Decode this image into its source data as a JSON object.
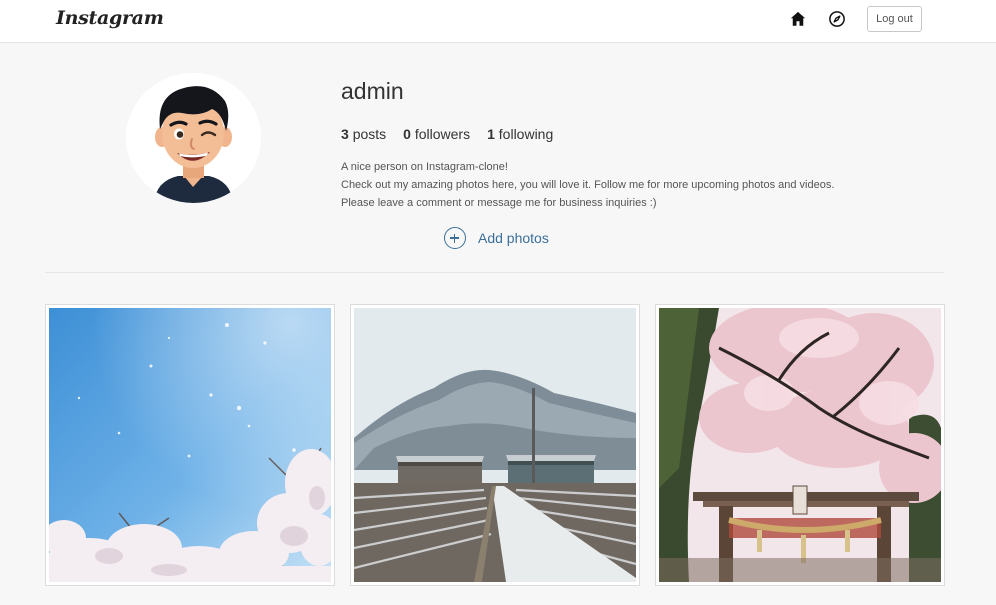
{
  "header": {
    "logo_text": "Instagram",
    "home_icon": "home-icon",
    "explore_icon": "compass-icon",
    "logout_label": "Log out"
  },
  "profile": {
    "username": "admin",
    "posts_count": "3",
    "posts_label": "posts",
    "followers_count": "0",
    "followers_label": "followers",
    "following_count": "1",
    "following_label": "following",
    "bio_lines": [
      "A nice person on Instagram-clone!",
      "Check out my amazing photos here, you will love it. Follow me for more upcoming photos and videos.",
      "Please leave a comment or message me for business inquiries :)"
    ],
    "add_photos_label": "Add photos",
    "add_photos_icon": "plus-circle-icon"
  },
  "posts": [
    {
      "subject": "cherry blossoms against blue sky with snow"
    },
    {
      "subject": "snowy mountain with farm buildings and road"
    },
    {
      "subject": "cherry blossoms over shrine torii gate"
    }
  ],
  "colors": {
    "background": "#f7f7f7",
    "accent": "#3b6f99",
    "text": "#262626"
  }
}
